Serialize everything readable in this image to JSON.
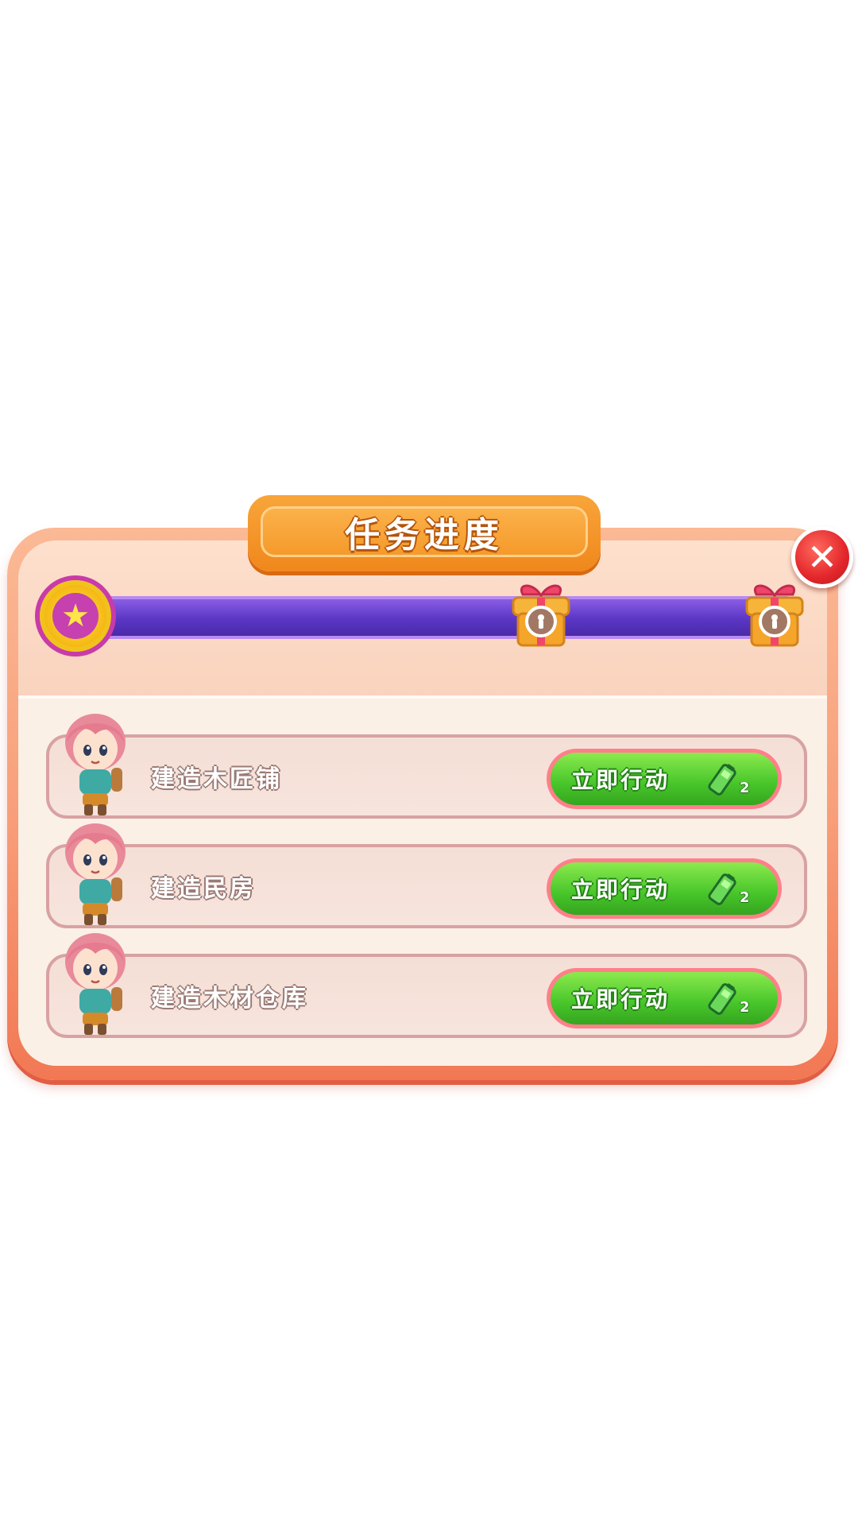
{
  "dialog": {
    "title": "任务进度",
    "close_symbol": "✕"
  },
  "progress": {
    "fraction": 0.0,
    "start_icon": "star-medal-icon",
    "rewards": [
      {
        "icon": "gift-locked-icon",
        "locked": true
      },
      {
        "icon": "gift-locked-icon",
        "locked": true
      }
    ],
    "star_symbol": "★"
  },
  "tasks": [
    {
      "label": "建造木匠铺",
      "button": "立即行动",
      "cost": "2",
      "cost_icon": "battery-icon"
    },
    {
      "label": "建造民房",
      "button": "立即行动",
      "cost": "2",
      "cost_icon": "battery-icon"
    },
    {
      "label": "建造木材仓库",
      "button": "立即行动",
      "cost": "2",
      "cost_icon": "battery-icon"
    }
  ],
  "colors": {
    "panel": "#f8a07b",
    "title_tab": "#f59a2b",
    "bar": "#5a36c4",
    "button": "#47c52a",
    "close": "#e3262b"
  }
}
